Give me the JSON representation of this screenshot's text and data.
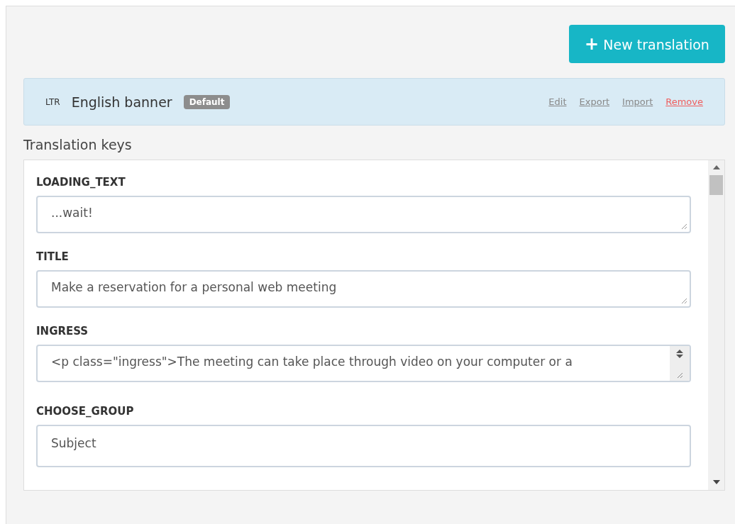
{
  "new_button": {
    "icon": "+",
    "label": "New translation"
  },
  "translation": {
    "direction": "LTR",
    "name": "English banner",
    "badge": "Default",
    "actions": [
      {
        "label": "Edit",
        "kind": "normal"
      },
      {
        "label": "Export",
        "kind": "normal"
      },
      {
        "label": "Import",
        "kind": "normal"
      },
      {
        "label": "Remove",
        "kind": "danger"
      }
    ]
  },
  "keys_heading": "Translation keys",
  "keys": [
    {
      "key": "LOADING_TEXT",
      "value": "...wait!",
      "kind": "textarea"
    },
    {
      "key": "TITLE",
      "value": "Make a reservation for a personal web meeting",
      "kind": "textarea"
    },
    {
      "key": "INGRESS",
      "value": "<p class=\"ingress\">The meeting can take place through video on your computer or a",
      "kind": "scrolling"
    },
    {
      "key": "CHOOSE_GROUP",
      "value": "Subject",
      "kind": "input"
    }
  ]
}
